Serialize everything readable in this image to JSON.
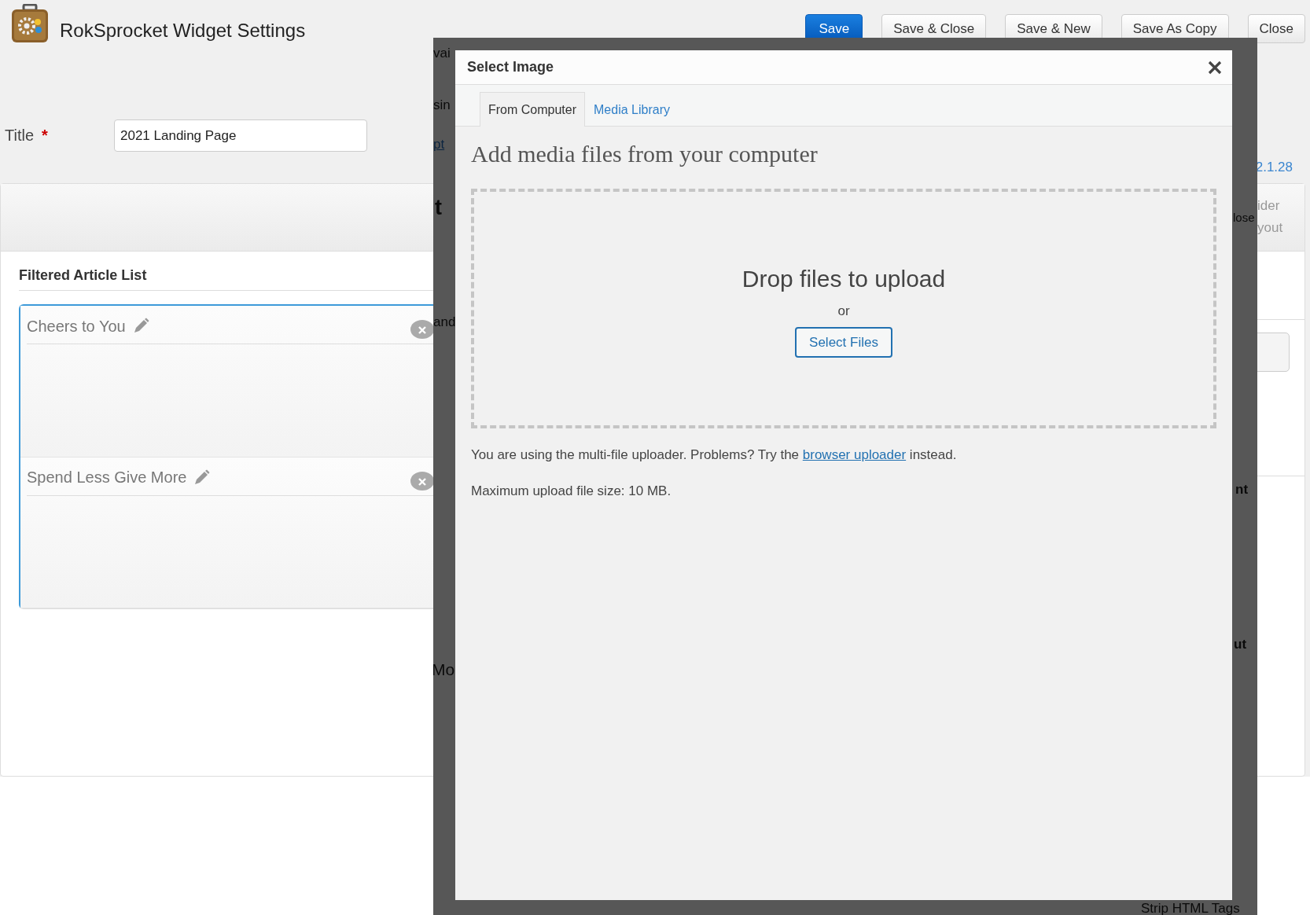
{
  "header": {
    "title": "RokSprocket Widget Settings",
    "buttons": [
      {
        "label": "Save",
        "primary": true
      },
      {
        "label": "Save & Close",
        "primary": false
      },
      {
        "label": "Save & New",
        "primary": false
      },
      {
        "label": "Save As Copy",
        "primary": false
      },
      {
        "label": "Close",
        "primary": false
      }
    ]
  },
  "title_field": {
    "label": "Title",
    "required_mark": "*",
    "value": "2021 Landing Page"
  },
  "version_link": "2.1.28",
  "side_tab_lines": [
    "ider",
    "yout"
  ],
  "article_list": {
    "heading": "Filtered Article List",
    "items": [
      {
        "title": "Cheers to You"
      },
      {
        "title": "Spend Less Give More"
      }
    ]
  },
  "covered_fragments": [
    {
      "text": "vai",
      "kind": "plain"
    },
    {
      "text": "sin",
      "kind": "plain"
    },
    {
      "text": "pt",
      "kind": "link"
    },
    {
      "text": "t",
      "kind": "heading"
    },
    {
      "text": "and",
      "kind": "plain"
    },
    {
      "text": "Mo",
      "kind": "large"
    },
    {
      "text": "lose",
      "kind": "plain"
    },
    {
      "text": "nt",
      "kind": "bold"
    },
    {
      "text": "ut",
      "kind": "bold"
    },
    {
      "text": "Strip HTML Tags",
      "kind": "plain"
    }
  ],
  "modal": {
    "title": "Select Image",
    "tabs": [
      {
        "label": "From Computer",
        "selected": true
      },
      {
        "label": "Media Library",
        "selected": false
      }
    ],
    "heading": "Add media files from your computer",
    "drop_text": "Drop files to upload",
    "or": "or",
    "select_button": "Select Files",
    "note": "You are using the multi-file uploader. Problems? Try the ",
    "note_link": "browser uploader",
    "note_end": " instead.",
    "max_size": "Maximum upload file size: 10 MB."
  }
}
